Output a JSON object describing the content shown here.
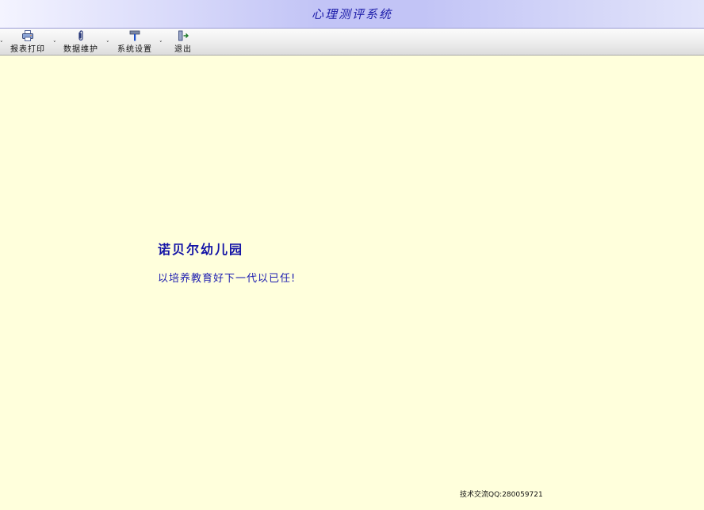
{
  "window": {
    "title": "心理测评系统"
  },
  "toolbar": {
    "items": [
      {
        "label": "报表打印",
        "icon": "printer-icon",
        "has_dropdown": true
      },
      {
        "label": "数据维护",
        "icon": "paperclip-icon",
        "has_dropdown": true
      },
      {
        "label": "系统设置",
        "icon": "hammer-icon",
        "has_dropdown": true
      },
      {
        "label": "退出",
        "icon": "exit-door-icon",
        "has_dropdown": false
      }
    ],
    "arrow_glyph": "˅"
  },
  "main": {
    "org_name": "诺贝尔幼儿园",
    "slogan": "以培养教育好下一代以已任!"
  },
  "footer": {
    "text": "技术交流QQ:280059721"
  },
  "colors": {
    "title_text": "#1a1aa8",
    "content_background": "#ffffdc",
    "heading_text": "#1414a6"
  }
}
